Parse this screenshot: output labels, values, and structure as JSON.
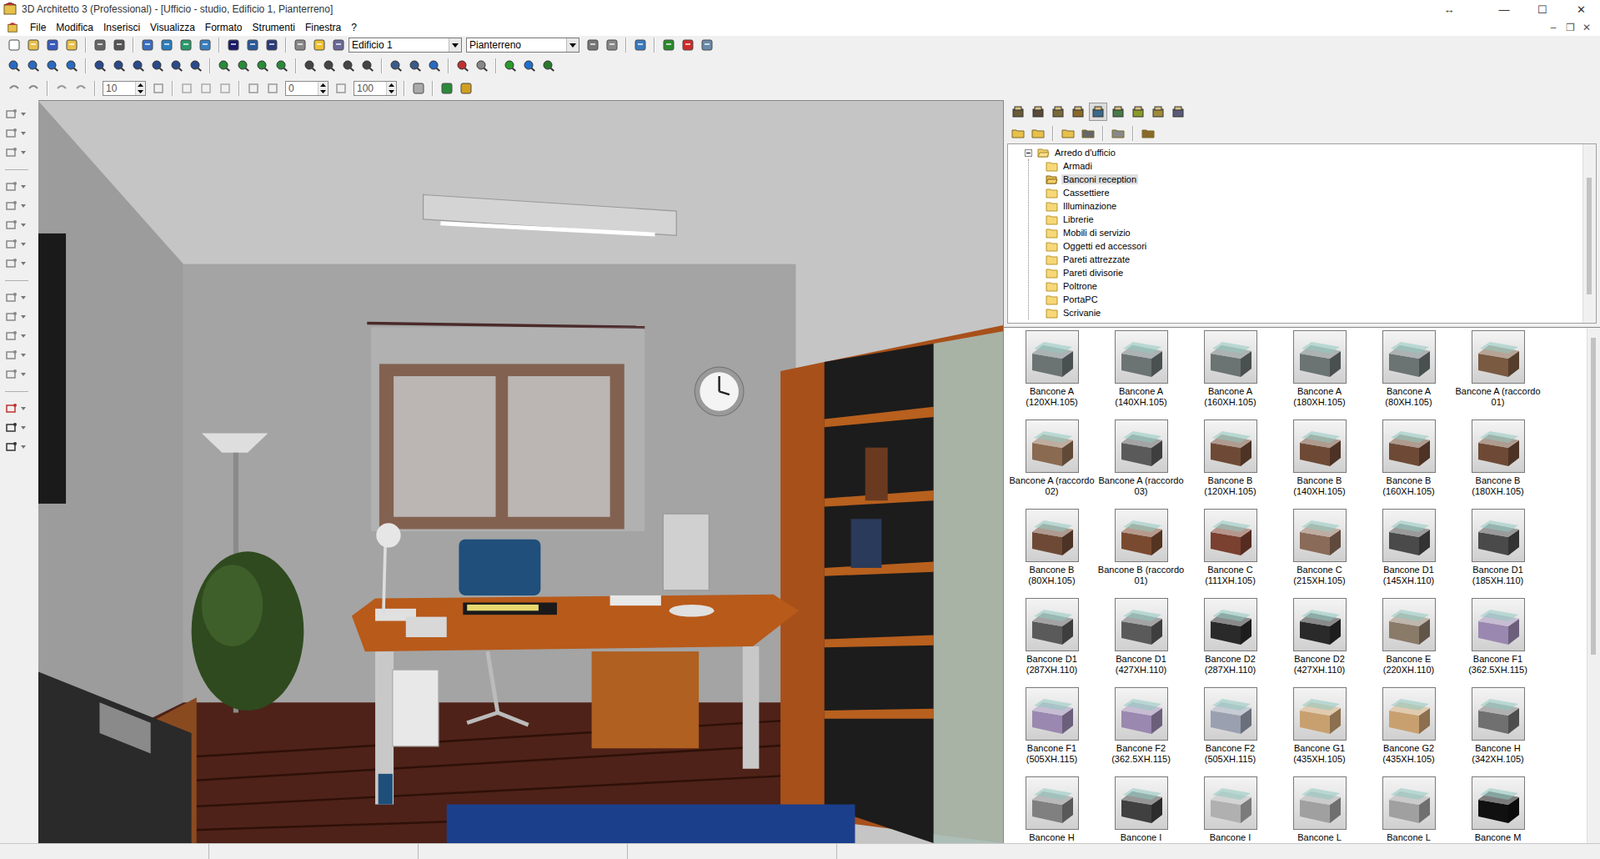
{
  "window": {
    "title": "3D Architetto 3 (Professional) - [Ufficio - studio, Edificio 1, Pianterreno]",
    "controls": [
      "↔",
      "—",
      "☐",
      "✕"
    ],
    "doc_controls": [
      "–",
      "❐",
      "✕"
    ]
  },
  "menu": [
    "File",
    "Modifica",
    "Inserisci",
    "Visualizza",
    "Formato",
    "Strumenti",
    "Finestra",
    "?"
  ],
  "toolbar": {
    "building": "Edificio 1",
    "floor": "Pianterreno",
    "fields": [
      "10",
      "0",
      "100"
    ]
  },
  "tree": {
    "root": "Arredo d'ufficio",
    "expanded": true,
    "items": [
      {
        "label": "Armadi",
        "selected": false
      },
      {
        "label": "Banconi reception",
        "selected": true
      },
      {
        "label": "Cassettiere",
        "selected": false
      },
      {
        "label": "Illuminazione",
        "selected": false
      },
      {
        "label": "Librerie",
        "selected": false
      },
      {
        "label": "Mobili di servizio",
        "selected": false
      },
      {
        "label": "Oggetti ed accessori",
        "selected": false
      },
      {
        "label": "Pareti attrezzate",
        "selected": false
      },
      {
        "label": "Pareti divisorie",
        "selected": false
      },
      {
        "label": "Poltrone",
        "selected": false
      },
      {
        "label": "PortaPC",
        "selected": false
      },
      {
        "label": "Scrivanie",
        "selected": false
      }
    ]
  },
  "catalog": [
    {
      "label": "Bancone A (120XH.105)",
      "color": "#6b7373"
    },
    {
      "label": "Bancone A (140XH.105)",
      "color": "#6b7373"
    },
    {
      "label": "Bancone A (160XH.105)",
      "color": "#6b7373"
    },
    {
      "label": "Bancone A (180XH.105)",
      "color": "#6b7373"
    },
    {
      "label": "Bancone A (80XH.105)",
      "color": "#6b7373"
    },
    {
      "label": "Bancone A (raccordo 01)",
      "color": "#7a5a40"
    },
    {
      "label": "Bancone A (raccordo 02)",
      "color": "#8a6a50"
    },
    {
      "label": "Bancone A (raccordo 03)",
      "color": "#5a5a5a"
    },
    {
      "label": "Bancone B (120XH.105)",
      "color": "#6e4a36"
    },
    {
      "label": "Bancone B (140XH.105)",
      "color": "#6e4a36"
    },
    {
      "label": "Bancone B (160XH.105)",
      "color": "#6e4a36"
    },
    {
      "label": "Bancone B (180XH.105)",
      "color": "#6e4a36"
    },
    {
      "label": "Bancone B (80XH.105)",
      "color": "#6e4a36"
    },
    {
      "label": "Bancone B (raccordo 01)",
      "color": "#7a4a30"
    },
    {
      "label": "Bancone C (111XH.105)",
      "color": "#7a4030"
    },
    {
      "label": "Bancone C (215XH.105)",
      "color": "#8a6a58"
    },
    {
      "label": "Bancone D1 (145XH.110)",
      "color": "#4a4a4a"
    },
    {
      "label": "Bancone D1 (185XH.110)",
      "color": "#4a4a4a"
    },
    {
      "label": "Bancone D1 (287XH.110)",
      "color": "#5a5a5a"
    },
    {
      "label": "Bancone D1 (427XH.110)",
      "color": "#5a5a5a"
    },
    {
      "label": "Bancone D2 (287XH.110)",
      "color": "#2a2a2a"
    },
    {
      "label": "Bancone D2 (427XH.110)",
      "color": "#2a2a2a"
    },
    {
      "label": "Bancone E (220XH.110)",
      "color": "#8a7a68"
    },
    {
      "label": "Bancone F1 (362.5XH.115)",
      "color": "#9a88b0"
    },
    {
      "label": "Bancone F1 (505XH.115)",
      "color": "#9a88b0"
    },
    {
      "label": "Bancone F2 (362.5XH.115)",
      "color": "#9a88b0"
    },
    {
      "label": "Bancone F2 (505XH.115)",
      "color": "#9aa0b0"
    },
    {
      "label": "Bancone G1 (435XH.105)",
      "color": "#c8a070"
    },
    {
      "label": "Bancone G2 (435XH.105)",
      "color": "#c8a070"
    },
    {
      "label": "Bancone H (342XH.105)",
      "color": "#707070"
    },
    {
      "label": "Bancone H",
      "color": "#808080"
    },
    {
      "label": "Bancone I",
      "color": "#404040"
    },
    {
      "label": "Bancone I",
      "color": "#b0b0b0"
    },
    {
      "label": "Bancone L",
      "color": "#a0a0a0"
    },
    {
      "label": "Bancone L",
      "color": "#a0a0a0"
    },
    {
      "label": "Bancone M",
      "color": "#101010"
    }
  ]
}
